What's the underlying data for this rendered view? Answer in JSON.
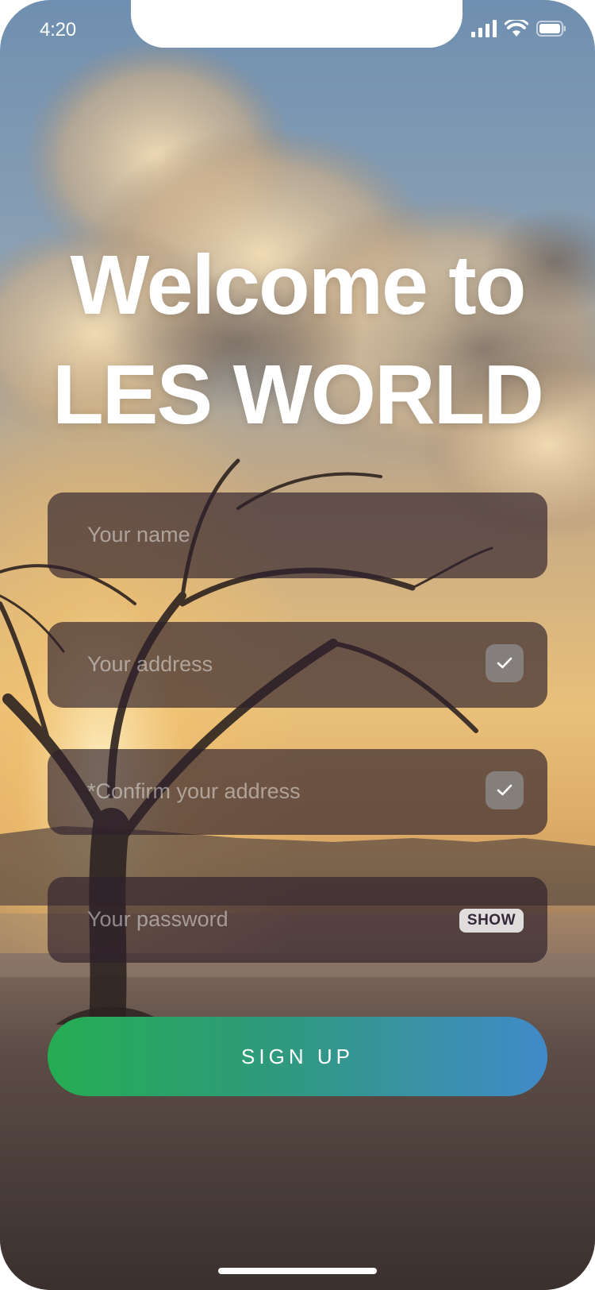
{
  "status_bar": {
    "time": "4:20"
  },
  "headline": {
    "line1": "Welcome to",
    "line2": "LES WORLD"
  },
  "form": {
    "name_placeholder": "Your name",
    "address_placeholder": "Your address",
    "confirm_address_placeholder": "*Confirm your address",
    "password_placeholder": "Your password",
    "show_label": "SHOW",
    "submit_label": "SIGN UP"
  },
  "colors": {
    "button_gradient_start": "#25ad52",
    "button_gradient_end": "#418ac9"
  },
  "icons": [
    "signal-icon",
    "wifi-icon",
    "battery-icon",
    "checkmark-icon"
  ]
}
